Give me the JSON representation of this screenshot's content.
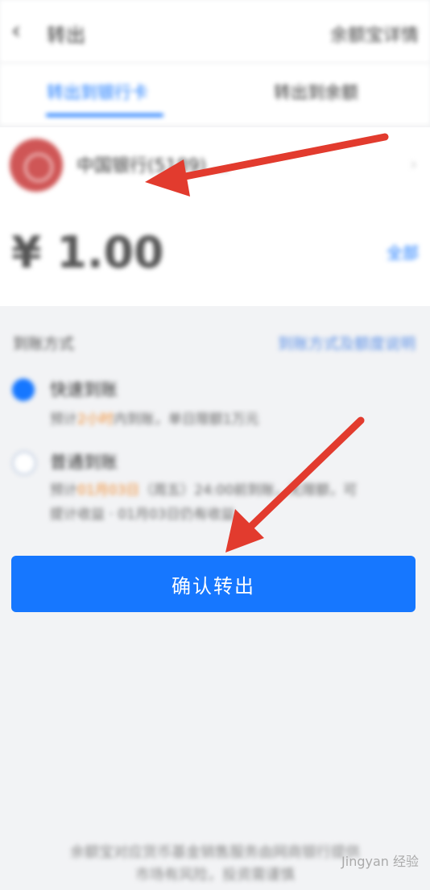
{
  "header": {
    "title": "转出",
    "right_label": "余额宝详情"
  },
  "tabs": [
    {
      "label": "转出到银行卡",
      "active": true
    },
    {
      "label": "转出到余额",
      "active": false
    }
  ],
  "bank": {
    "name": "中国银行(5189) ...",
    "chevron": "›"
  },
  "amount": {
    "value": "¥ 1.00",
    "link_label": "全部"
  },
  "arrival": {
    "section_label": "到账方式",
    "section_link": "到账方式及额度说明",
    "options": [
      {
        "title": "快速到账",
        "desc_prefix": "预计",
        "desc_highlight": "2小时",
        "desc_suffix": "内到账，单日限额1万元",
        "selected": true
      },
      {
        "title": "普通到账",
        "desc_prefix": "预计",
        "desc_highlight": "01月03日",
        "desc_suffix": "（周五）24:00前到账，无限额，可",
        "desc_line2": "提计收益 · 01月03日仍有收益",
        "selected": false
      }
    ]
  },
  "confirm_label": "确认转出",
  "footer": {
    "line1": "余额宝对应货币基金销售服务由网商银行提供",
    "line2": "市场有风险，投资需谨慎",
    "watermark": "Jingyan 经验"
  },
  "colors": {
    "accent": "#1677ff",
    "arrow": "#e23b2e",
    "highlight": "#f08a2c"
  }
}
